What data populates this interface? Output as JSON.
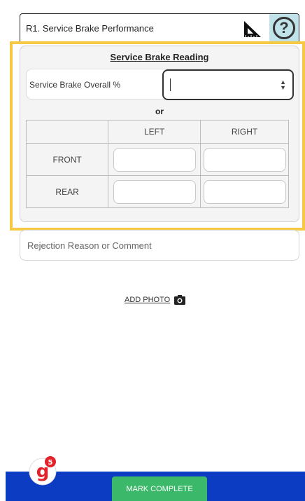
{
  "item": {
    "title": "R1. Service Brake Performance",
    "help_glyph": "?",
    "tool_icon": "set-square-icon",
    "help_icon": "question-circle-icon"
  },
  "panel": {
    "heading": "Service Brake Reading",
    "overall_label": "Service Brake Overall %",
    "overall_value": "",
    "or_label": "or",
    "columns": [
      "",
      "LEFT",
      "RIGHT"
    ],
    "rows": [
      {
        "label": "FRONT",
        "left": "",
        "right": ""
      },
      {
        "label": "REAR",
        "left": "",
        "right": ""
      }
    ]
  },
  "comment": {
    "placeholder": "Rejection Reason or Comment"
  },
  "photo": {
    "label": "ADD PHOTO",
    "icon": "camera-icon"
  },
  "footer": {
    "mark_complete_label": "MARK COMPLETE",
    "logo_letter": "g",
    "logo_badge_count": "5"
  },
  "colors": {
    "highlight": "#f6c945",
    "help_bg": "#bfe3e8",
    "footer_bg": "#0b3cc1",
    "primary_button": "#3cb86a",
    "logo_red": "#e2212b"
  }
}
